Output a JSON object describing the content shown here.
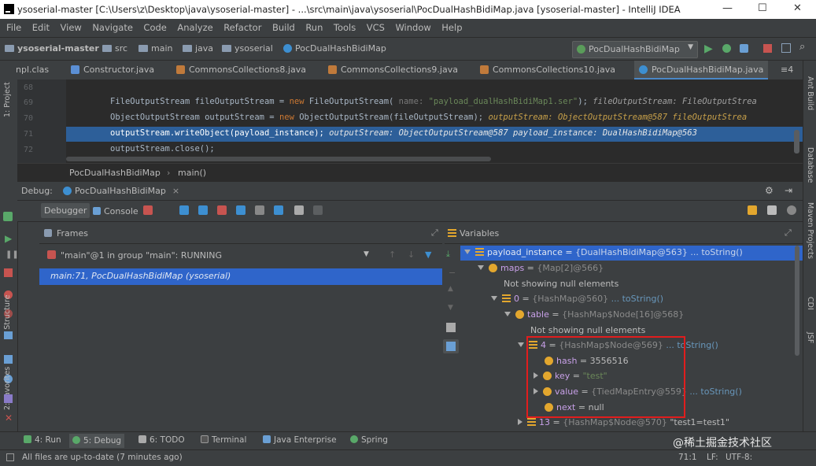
{
  "window": {
    "title": "ysoserial-master [C:\\Users\\z\\Desktop\\java\\ysoserial-master] - ...\\src\\main\\java\\ysoserial\\PocDualHashBidiMap.java [ysoserial-master] - IntelliJ IDEA",
    "min": "—",
    "max": "☐",
    "close": "✕"
  },
  "menu": [
    "File",
    "Edit",
    "View",
    "Navigate",
    "Code",
    "Analyze",
    "Refactor",
    "Build",
    "Run",
    "Tools",
    "VCS",
    "Window",
    "Help"
  ],
  "nav": {
    "project": "ysoserial-master",
    "crumbs": [
      "src",
      "main",
      "java",
      "ysoserial",
      "PocDualHashBidiMap"
    ],
    "run_config": "PocDualHashBidiMap"
  },
  "tabs": [
    "npl.clas",
    "Constructor.java",
    "CommonsCollections8.java",
    "CommonsCollections9.java",
    "CommonsCollections10.java",
    "PocDualHashBidiMap.java"
  ],
  "tabs_more": "≡4",
  "editor": {
    "lines": [
      {
        "num": "68",
        "code": ""
      },
      {
        "num": "69",
        "pre": "FileOutputStream fileOutputStream = ",
        "kw": "new",
        "post": " FileOutputStream(",
        "hint": " name: ",
        "str": "\"payload_dualHashBidiMap1.ser\"",
        "end": ");",
        "dbg": "  fileOutputStream: FileOutputStrea"
      },
      {
        "num": "70",
        "pre": "ObjectOutputStream outputStream = ",
        "kw": "new",
        "post": " ObjectOutputStream(fileOutputStream);",
        "dbg": "  outputStream: ObjectOutputStream@587  fileOutputStrea"
      },
      {
        "num": "71",
        "pre": "outputStream.writeObject(payload_instance);",
        "dbg": "  outputStream: ObjectOutputStream@587  payload_instance: DualHashBidiMap@563"
      },
      {
        "num": "72",
        "pre": "outputStream.close();"
      }
    ],
    "breadcrumb": [
      "PocDualHashBidiMap",
      "main()"
    ]
  },
  "debug": {
    "label": "Debug:",
    "config": "PocDualHashBidiMap",
    "tab_debugger": "Debugger",
    "tab_console": "Console",
    "frames_title": "Frames",
    "variables_title": "Variables",
    "thread": "\"main\"@1 in group \"main\": RUNNING",
    "frame": "main:71, PocDualHashBidiMap (ysoserial)",
    "vars": {
      "root": {
        "name": "payload_instance",
        "eq": " = ",
        "val": "{DualHashBidiMap@563}",
        "link": " ... toString()"
      },
      "maps": {
        "name": "maps",
        "eq": " = ",
        "val": "{Map[2]@566}"
      },
      "null1": "Not showing null elements",
      "zero": {
        "name": "0",
        "eq": " = ",
        "val": "{HashMap@560}",
        "link": " ... toString()"
      },
      "table": {
        "name": "table",
        "eq": " = ",
        "val": "{HashMap$Node[16]@568}"
      },
      "null2": "Not showing null elements",
      "four": {
        "name": "4",
        "eq": " = ",
        "val": "{HashMap$Node@569}",
        "link": " ... toString()"
      },
      "hash": {
        "name": "hash",
        "eq": " = ",
        "val": "3556516"
      },
      "key": {
        "name": "key",
        "eq": " = ",
        "val": "\"test\""
      },
      "value": {
        "name": "value",
        "eq": " = ",
        "val": "{TiedMapEntry@559}",
        "link": " ... toString()"
      },
      "next": {
        "name": "next",
        "eq": " = ",
        "val": "null"
      },
      "thirteen": {
        "name": "13",
        "eq": " = ",
        "val": "{HashMap$Node@570}",
        "str": " \"test1=test1\""
      }
    }
  },
  "left_strip": [
    "1: Project",
    "2: Structure",
    "2: Favorites"
  ],
  "right_strip": [
    "Ant Build",
    "Database",
    "Maven Projects",
    "CDI",
    "JSF"
  ],
  "bottom_tabs": [
    "4: Run",
    "5: Debug",
    "6: TODO",
    "Terminal",
    "Java Enterprise",
    "Spring"
  ],
  "status": {
    "message": "All files are up-to-date (7 minutes ago)",
    "position": "71:1",
    "line_sep": "LF:",
    "encoding": "UTF-8:",
    "watermark": "@稀土掘金技术社区"
  },
  "colors": {
    "selection": "#2f65ca",
    "highlight": "#e11d1d",
    "accent": "#4a88c7"
  }
}
